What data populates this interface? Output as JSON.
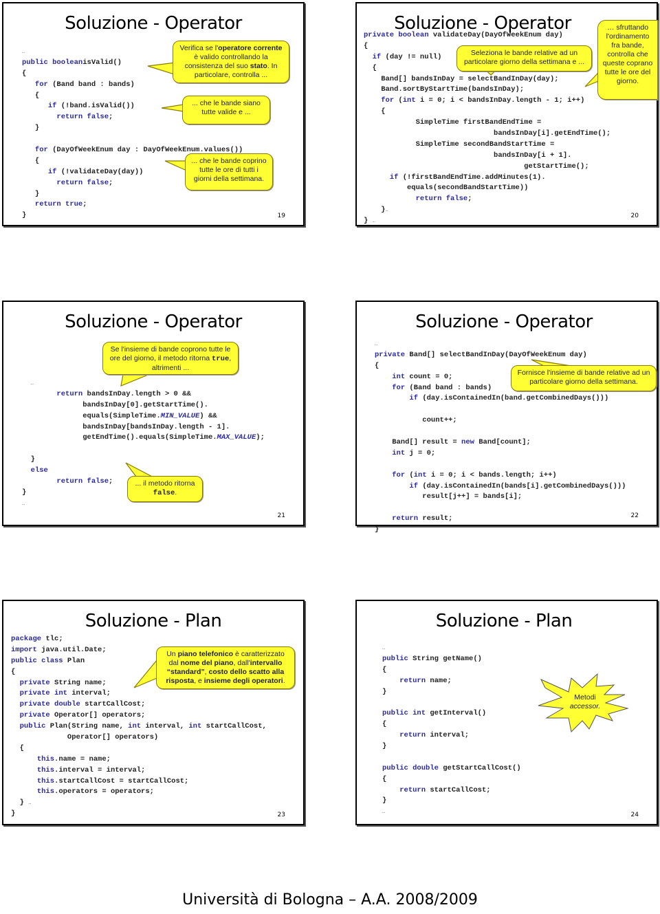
{
  "footer": "Università di Bologna – A.A. 2008/2009",
  "slides": [
    {
      "title": "Soluzione - Operator",
      "number": "19",
      "code": [
        [
          [
            "",
            "…",
            "dots"
          ]
        ],
        [
          [
            "kw",
            "public boolean"
          ],
          [
            "",
            "isValid()"
          ]
        ],
        [
          [
            "",
            "{"
          ]
        ],
        [
          [
            "",
            "   "
          ],
          [
            "kw",
            "for"
          ],
          [
            "",
            " (Band band : bands)"
          ]
        ],
        [
          [
            "",
            "   {"
          ]
        ],
        [
          [
            "",
            "      "
          ],
          [
            "kw",
            "if"
          ],
          [
            "",
            " (!band.isValid())"
          ]
        ],
        [
          [
            "",
            "        "
          ],
          [
            "kw",
            "return false"
          ],
          [
            "",
            ";"
          ]
        ],
        [
          [
            "",
            "   }"
          ]
        ],
        [
          [
            "",
            ""
          ]
        ],
        [
          [
            "",
            "   "
          ],
          [
            "kw",
            "for"
          ],
          [
            "",
            " (DayOfWeekEnum day : DayOfWeekEnum.values())"
          ]
        ],
        [
          [
            "",
            "   {"
          ]
        ],
        [
          [
            "",
            "      "
          ],
          [
            "kw",
            "if"
          ],
          [
            "",
            " (!validateDay(day))"
          ]
        ],
        [
          [
            "",
            "        "
          ],
          [
            "kw",
            "return false"
          ],
          [
            "",
            ";"
          ]
        ],
        [
          [
            "",
            "   }"
          ]
        ],
        [
          [
            "",
            "   "
          ],
          [
            "kw",
            "return true"
          ],
          [
            "",
            ";"
          ]
        ],
        [
          [
            "",
            "}"
          ]
        ],
        [
          [
            "",
            "…",
            "dots"
          ]
        ]
      ],
      "callouts": [
        {
          "parts": [
            [
              "",
              "Verifica se l'"
            ],
            [
              "b",
              "operatore corrente"
            ],
            [
              "",
              " è valido controllando la consistenza del suo "
            ],
            [
              "b",
              "stato"
            ],
            [
              "",
              ". In particolare, controlla ..."
            ]
          ]
        },
        {
          "parts": [
            [
              "",
              "... che le bande siano tutte valide e ..."
            ]
          ]
        },
        {
          "parts": [
            [
              "",
              "... che le bande coprino tutte le ore di tutti i giorni della settimana."
            ]
          ]
        }
      ]
    },
    {
      "title": "Soluzione - Operator",
      "number": "20",
      "code": [
        [
          [
            "kw",
            "private boolean"
          ],
          [
            "",
            " validateDay(DayOfWeekEnum day)"
          ]
        ],
        [
          [
            "",
            "{"
          ]
        ],
        [
          [
            "",
            "  "
          ],
          [
            "kw",
            "if"
          ],
          [
            "",
            " (day != null)"
          ]
        ],
        [
          [
            "",
            "  {"
          ]
        ],
        [
          [
            "",
            "    Band[] bandsInDay = selectBandInDay(day);"
          ]
        ],
        [
          [
            "",
            "    Band.sortByStartTime(bandsInDay);"
          ]
        ],
        [
          [
            "",
            "    "
          ],
          [
            "kw",
            "for"
          ],
          [
            "",
            " ("
          ],
          [
            "kw",
            "int"
          ],
          [
            "",
            " i = 0; i < bandsInDay.length - 1; i++)"
          ]
        ],
        [
          [
            "",
            "    {"
          ]
        ],
        [
          [
            "",
            "            SimpleTime firstBandEndTime ="
          ]
        ],
        [
          [
            "",
            "                              bandsInDay[i].getEndTime();"
          ]
        ],
        [
          [
            "",
            "            SimpleTime secondBandStartTime ="
          ]
        ],
        [
          [
            "",
            "                              bandsInDay[i + 1]."
          ]
        ],
        [
          [
            "",
            "                                     getStartTime();"
          ]
        ],
        [
          [
            "",
            "      "
          ],
          [
            "kw",
            "if"
          ],
          [
            "",
            " (!firstBandEndTime.addMinutes(1)."
          ]
        ],
        [
          [
            "",
            "          equals(secondBandStartTime))"
          ]
        ],
        [
          [
            "",
            "            "
          ],
          [
            "kw",
            "return false"
          ],
          [
            "",
            ";"
          ]
        ],
        [
          [
            "",
            "    }"
          ],
          [
            "",
            "…",
            "dots"
          ]
        ],
        [
          [
            "",
            "} "
          ],
          [
            "",
            "…",
            "dots"
          ]
        ]
      ],
      "callouts": [
        {
          "parts": [
            [
              "",
              "Seleziona le bande relative ad un particolare giorno della settimana e ..."
            ]
          ]
        },
        {
          "parts": [
            [
              "",
              "… sfruttando l'ordinamento fra bande, controlla che queste coprano tutte le ore del giorno."
            ]
          ]
        }
      ]
    },
    {
      "title": "Soluzione - Operator",
      "number": "21",
      "code": [
        [
          [
            "",
            "  "
          ],
          [
            "",
            "…",
            "dots"
          ]
        ],
        [
          [
            "",
            "        "
          ],
          [
            "kw",
            "return"
          ],
          [
            "",
            " bandsInDay.length > 0 &&"
          ]
        ],
        [
          [
            "",
            "              bandsInDay[0].getStartTime()."
          ]
        ],
        [
          [
            "",
            "              equals(SimpleTime."
          ],
          [
            "it",
            "MIN_VALUE"
          ],
          [
            "",
            ") &&"
          ]
        ],
        [
          [
            "",
            "              bandsInDay[bandsInDay.length - 1]."
          ]
        ],
        [
          [
            "",
            "              getEndTime().equals(SimpleTime."
          ],
          [
            "it",
            "MAX_VALUE"
          ],
          [
            "",
            ");"
          ]
        ],
        [
          [
            "",
            ""
          ]
        ],
        [
          [
            "",
            "  }"
          ]
        ],
        [
          [
            "",
            "  "
          ],
          [
            "kw",
            "else"
          ]
        ],
        [
          [
            "",
            "        "
          ],
          [
            "kw",
            "return false"
          ],
          [
            "",
            ";"
          ]
        ],
        [
          [
            "",
            "}"
          ]
        ],
        [
          [
            "",
            "…",
            "dots"
          ]
        ]
      ],
      "callouts": [
        {
          "parts": [
            [
              "",
              "Se l'insieme di bande coprono tutte le ore del giorno, il metodo ritorna "
            ],
            [
              "mono",
              "true"
            ],
            [
              "",
              ", altrimenti ..."
            ]
          ]
        },
        {
          "parts": [
            [
              "",
              "... il metodo ritorna "
            ],
            [
              "mono",
              "false"
            ],
            [
              "",
              "."
            ]
          ]
        }
      ]
    },
    {
      "title": "Soluzione - Operator",
      "number": "22",
      "code": [
        [
          [
            "",
            "…",
            "dots"
          ]
        ],
        [
          [
            "kw",
            "private"
          ],
          [
            "",
            " Band[] selectBandInDay(DayOfWeekEnum day)"
          ]
        ],
        [
          [
            "",
            "{"
          ]
        ],
        [
          [
            "",
            "    "
          ],
          [
            "kw",
            "int"
          ],
          [
            "",
            " count = 0;"
          ]
        ],
        [
          [
            "",
            "    "
          ],
          [
            "kw",
            "for"
          ],
          [
            "",
            " (Band band : bands)"
          ]
        ],
        [
          [
            "",
            "        "
          ],
          [
            "kw",
            "if"
          ],
          [
            "",
            " (day.isContainedIn(band.getCombinedDays()))"
          ]
        ],
        [
          [
            "",
            ""
          ]
        ],
        [
          [
            "",
            "           count++;"
          ]
        ],
        [
          [
            "",
            ""
          ]
        ],
        [
          [
            "",
            "    Band[] result = "
          ],
          [
            "kw",
            "new"
          ],
          [
            "",
            " Band[count];"
          ]
        ],
        [
          [
            "",
            "    "
          ],
          [
            "kw",
            "int"
          ],
          [
            "",
            " j = 0;"
          ]
        ],
        [
          [
            "",
            ""
          ]
        ],
        [
          [
            "",
            "    "
          ],
          [
            "kw",
            "for"
          ],
          [
            "",
            " ("
          ],
          [
            "kw",
            "int"
          ],
          [
            "",
            " i = 0; i < bands.length; i++)"
          ]
        ],
        [
          [
            "",
            "        "
          ],
          [
            "kw",
            "if"
          ],
          [
            "",
            " (day.isContainedIn(bands[i].getCombinedDays()))"
          ]
        ],
        [
          [
            "",
            "           result[j++] = bands[i];"
          ]
        ],
        [
          [
            "",
            ""
          ]
        ],
        [
          [
            "",
            "    "
          ],
          [
            "kw",
            "return"
          ],
          [
            "",
            " result;"
          ]
        ],
        [
          [
            "",
            "}"
          ]
        ]
      ],
      "callouts": [
        {
          "parts": [
            [
              "",
              "Fornisce l'insieme di bande relative ad un particolare giorno della settimana."
            ]
          ]
        }
      ]
    },
    {
      "title": "Soluzione - Plan",
      "number": "23",
      "code": [
        [
          [
            "kw",
            "package"
          ],
          [
            "",
            " tlc;"
          ]
        ],
        [
          [
            "kw",
            "import"
          ],
          [
            "",
            " java.util.Date;"
          ]
        ],
        [
          [
            "kw",
            "public class"
          ],
          [
            "",
            " Plan"
          ]
        ],
        [
          [
            "",
            "{"
          ]
        ],
        [
          [
            "",
            "  "
          ],
          [
            "kw",
            "private"
          ],
          [
            "",
            " String name;"
          ]
        ],
        [
          [
            "",
            "  "
          ],
          [
            "kw",
            "private int"
          ],
          [
            "",
            " interval;"
          ]
        ],
        [
          [
            "",
            "  "
          ],
          [
            "kw",
            "private double"
          ],
          [
            "",
            " startCallCost;"
          ]
        ],
        [
          [
            "",
            "  "
          ],
          [
            "kw",
            "private"
          ],
          [
            "",
            " Operator[] operators;"
          ]
        ],
        [
          [
            "",
            "  "
          ],
          [
            "kw",
            "public"
          ],
          [
            "",
            " Plan(String name, "
          ],
          [
            "kw",
            "int"
          ],
          [
            "",
            " interval, "
          ],
          [
            "kw",
            "int"
          ],
          [
            "",
            " startCallCost,"
          ]
        ],
        [
          [
            "",
            "             Operator[] operators)"
          ]
        ],
        [
          [
            "",
            "  {"
          ]
        ],
        [
          [
            "",
            "      "
          ],
          [
            "kw",
            "this"
          ],
          [
            "",
            ".name = name;"
          ]
        ],
        [
          [
            "",
            "      "
          ],
          [
            "kw",
            "this"
          ],
          [
            "",
            ".interval = interval;"
          ]
        ],
        [
          [
            "",
            "      "
          ],
          [
            "kw",
            "this"
          ],
          [
            "",
            ".startCallCost = startCallCost;"
          ]
        ],
        [
          [
            "",
            "      "
          ],
          [
            "kw",
            "this"
          ],
          [
            "",
            ".operators = operators;"
          ]
        ],
        [
          [
            "",
            "  } "
          ],
          [
            "",
            "…",
            "dots"
          ]
        ],
        [
          [
            "",
            "}"
          ]
        ]
      ],
      "callouts": [
        {
          "parts": [
            [
              "",
              "Un "
            ],
            [
              "b",
              "piano telefonico"
            ],
            [
              "",
              " è caratterizzato dal "
            ],
            [
              "b",
              "nome del piano"
            ],
            [
              "",
              ", dall'"
            ],
            [
              "b",
              "intervallo “standard”"
            ],
            [
              "",
              ", "
            ],
            [
              "b",
              "costo dello scatto alla risposta"
            ],
            [
              "",
              ", e "
            ],
            [
              "b",
              "insieme degli operatori"
            ],
            [
              "",
              "."
            ]
          ]
        }
      ]
    },
    {
      "title": "Soluzione - Plan",
      "number": "24",
      "code": [
        [
          [
            "",
            "…",
            "dots"
          ]
        ],
        [
          [
            "kw",
            "public"
          ],
          [
            "",
            " String getName()"
          ]
        ],
        [
          [
            "",
            "{"
          ]
        ],
        [
          [
            "",
            "    "
          ],
          [
            "kw",
            "return"
          ],
          [
            "",
            " name;"
          ]
        ],
        [
          [
            "",
            "}"
          ]
        ],
        [
          [
            "",
            ""
          ]
        ],
        [
          [
            "kw",
            "public int"
          ],
          [
            "",
            " getInterval()"
          ]
        ],
        [
          [
            "",
            "{"
          ]
        ],
        [
          [
            "",
            "    "
          ],
          [
            "kw",
            "return"
          ],
          [
            "",
            " interval;"
          ]
        ],
        [
          [
            "",
            "}"
          ]
        ],
        [
          [
            "",
            ""
          ]
        ],
        [
          [
            "kw",
            "public double"
          ],
          [
            "",
            " getStartCallCost()"
          ]
        ],
        [
          [
            "",
            "{"
          ]
        ],
        [
          [
            "",
            "    "
          ],
          [
            "kw",
            "return"
          ],
          [
            "",
            " startCallCost;"
          ]
        ],
        [
          [
            "",
            "}"
          ]
        ],
        [
          [
            "",
            "…",
            "dots"
          ]
        ]
      ],
      "callouts": [
        {
          "parts": [
            [
              "",
              "Metodi "
            ],
            [
              "i",
              "accessor."
            ]
          ]
        }
      ]
    }
  ]
}
